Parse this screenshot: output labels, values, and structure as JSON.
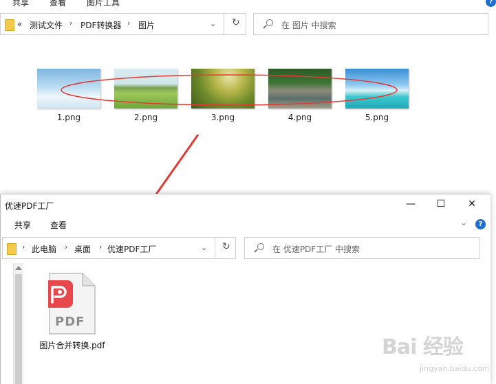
{
  "back_window": {
    "ribbon_tabs": [
      "共享",
      "查看",
      "图片工具"
    ],
    "address": {
      "overflow": "«",
      "crumbs": [
        "测试文件",
        "PDF转换器",
        "图片"
      ],
      "separator": "›"
    },
    "search": {
      "placeholder": "在 图片 中搜索"
    },
    "files": [
      {
        "name": "1.png",
        "theme": "sky-clouds"
      },
      {
        "name": "2.png",
        "theme": "green-field"
      },
      {
        "name": "3.png",
        "theme": "yellow-flowers"
      },
      {
        "name": "4.png",
        "theme": "forest-river"
      },
      {
        "name": "5.png",
        "theme": "tropical-sea"
      }
    ],
    "help_icon": "?"
  },
  "front_window": {
    "title": "优速PDF工厂",
    "controls": {
      "minimize": "—",
      "maximize": "☐",
      "close": "✕"
    },
    "ribbon_tabs": [
      "共享",
      "查看"
    ],
    "address": {
      "crumbs": [
        "此电脑",
        "桌面",
        "优速PDF工厂"
      ],
      "separator": "›"
    },
    "search": {
      "placeholder": "在 优速PDF工厂 中搜索"
    },
    "files": [
      {
        "name": "图片合并转换.pdf",
        "icon": "pdf-document-icon",
        "badge_text": "PDF"
      }
    ],
    "help_icon": "?"
  },
  "watermark": {
    "text": "Bai  经验",
    "sub": "jingyan.baidu.com"
  },
  "colors": {
    "annotation_red": "#e53935",
    "accent_blue": "#1a6fd1",
    "pdf_badge": "#e8474c"
  }
}
